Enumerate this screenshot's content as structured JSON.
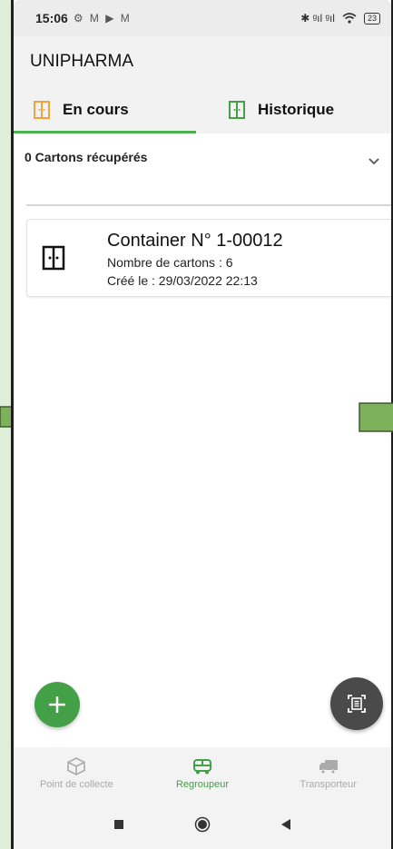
{
  "status_bar": {
    "time": "15:06",
    "left_icons": "⚙ M ▶ M",
    "signal": "✱ ᵍıl ᵍıl",
    "battery": "23"
  },
  "app": {
    "title": "UNIPHARMA"
  },
  "tabs": [
    {
      "label": "En cours",
      "active": true,
      "icon_color": "#f2a33a"
    },
    {
      "label": "Historique",
      "active": false,
      "icon_color": "#43a047"
    }
  ],
  "summary": {
    "text": "0 Cartons récupérés"
  },
  "card": {
    "title": "Container N° 1-00012",
    "cartons": "Nombre de cartons : 6",
    "created": "Créé le : 29/03/2022 22:13"
  },
  "fab": {
    "add_icon": "plus-icon",
    "scan_icon": "document-scan-icon"
  },
  "bottom_nav": [
    {
      "label": "Point de collecte",
      "icon": "box-icon",
      "active": false
    },
    {
      "label": "Regroupeur",
      "icon": "bus-icon",
      "active": true
    },
    {
      "label": "Transporteur",
      "icon": "truck-icon",
      "active": false
    }
  ],
  "colors": {
    "accent": "#43a047",
    "tab_orange": "#f2a33a",
    "fab_dark": "#4a4a4a",
    "annotation_arrow": "#7cb35a"
  }
}
